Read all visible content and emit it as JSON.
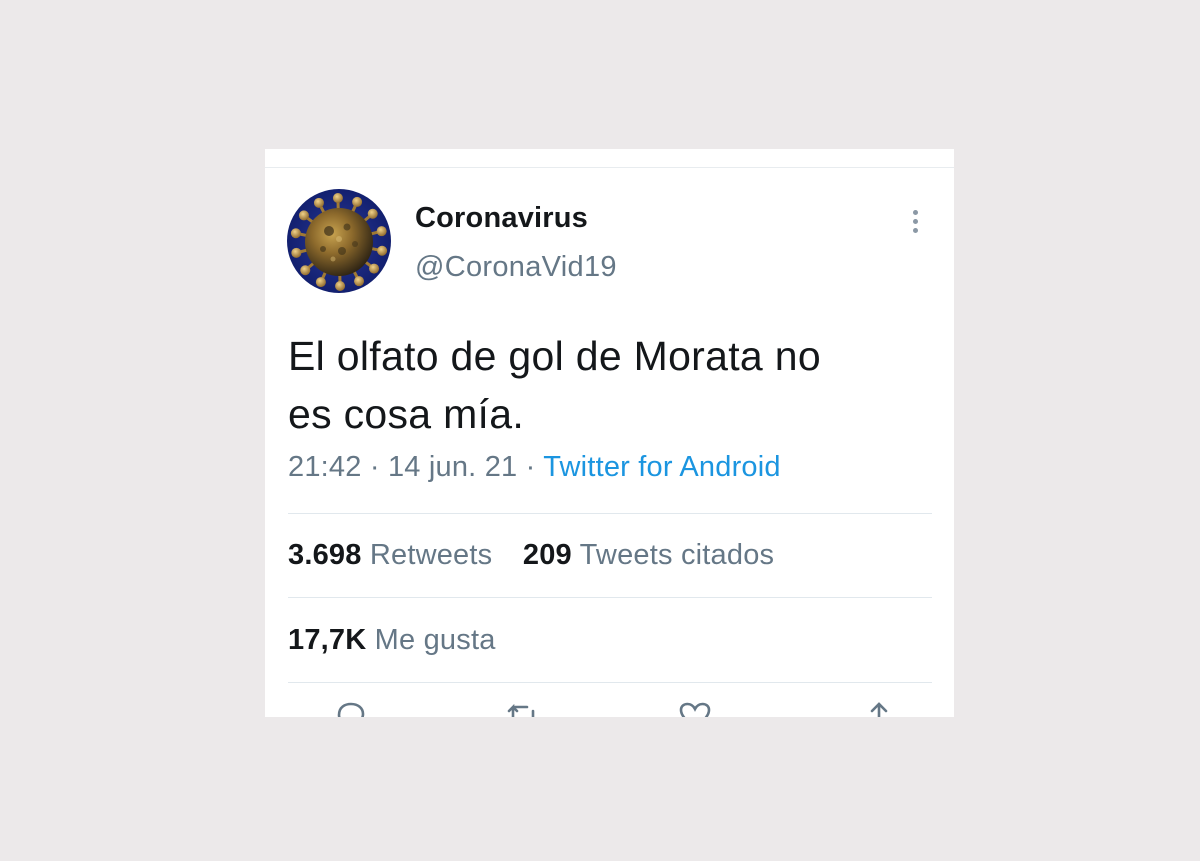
{
  "tweet": {
    "author": {
      "display_name": "Coronavirus",
      "handle": "@CoronaVid19",
      "avatar_icon": "coronavirus-avatar"
    },
    "text_line1": "El olfato de gol de Morata no",
    "text_line2": "es cosa mía.",
    "time": "21:42",
    "date": "14 jun. 21",
    "separator": "·",
    "source": "Twitter for Android",
    "source_color": "#1b95e0",
    "retweets_count": "3.698",
    "retweets_label": "Retweets",
    "quote_count": "209",
    "quote_label": "Tweets citados",
    "likes_count": "17,7K",
    "likes_label": "Me gusta"
  },
  "actions": [
    {
      "name": "reply",
      "icon": "reply-icon"
    },
    {
      "name": "retweet",
      "icon": "retweet-icon"
    },
    {
      "name": "like",
      "icon": "heart-icon"
    },
    {
      "name": "share",
      "icon": "share-icon"
    }
  ],
  "colors": {
    "background": "#ece9ea",
    "card": "#ffffff",
    "primary_text": "#14171a",
    "secondary_text": "#657786",
    "divider": "#e1e8ed"
  }
}
